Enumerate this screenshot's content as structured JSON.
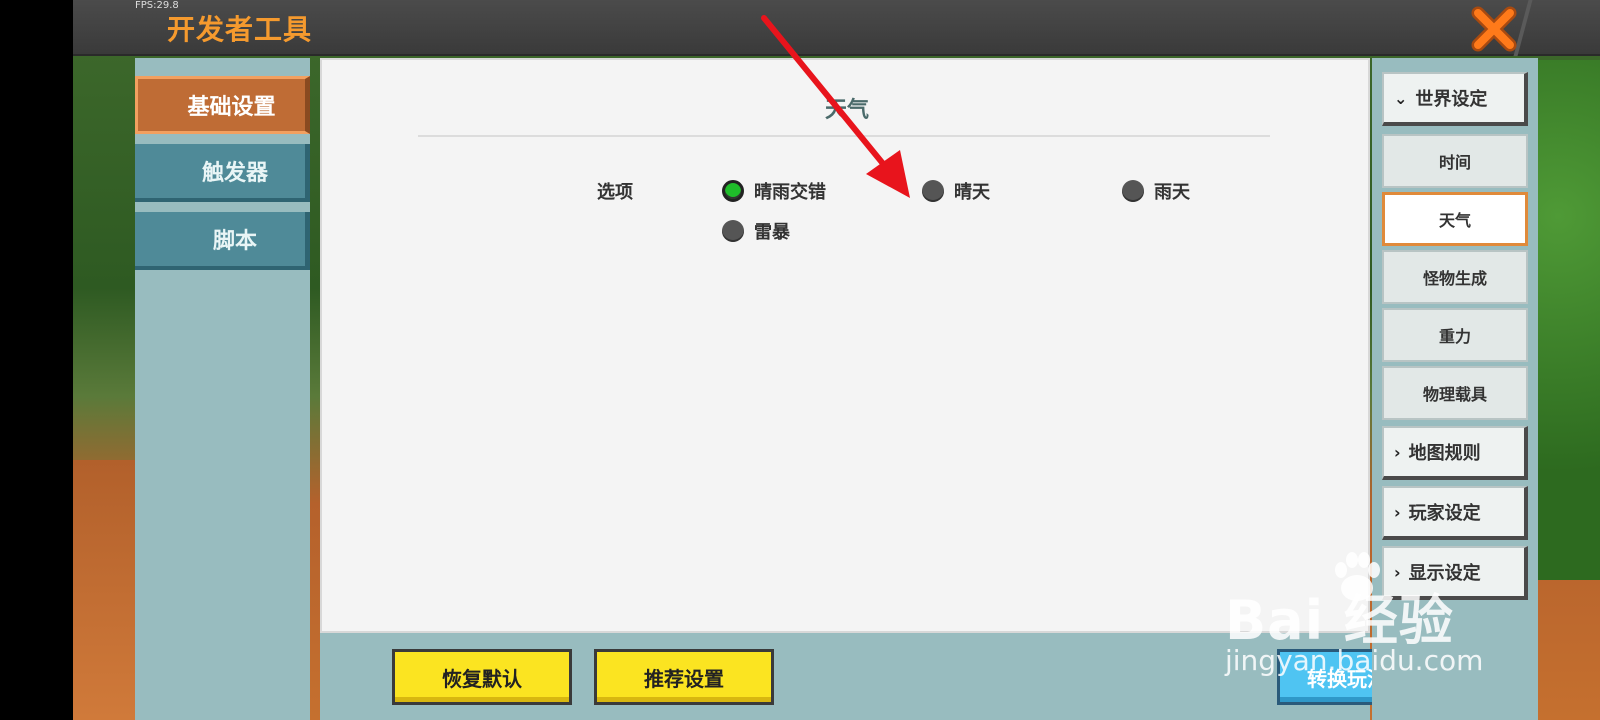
{
  "topbar": {
    "fps": "FPS:29.8",
    "title": "开发者工具"
  },
  "sidebar": {
    "items": [
      {
        "label": "基础设置",
        "active": true
      },
      {
        "label": "触发器",
        "active": false
      },
      {
        "label": "脚本",
        "active": false
      }
    ]
  },
  "main": {
    "section_title": "天气",
    "option_label": "选项",
    "options": [
      {
        "label": "晴雨交错",
        "selected": true
      },
      {
        "label": "晴天",
        "selected": false
      },
      {
        "label": "雨天",
        "selected": false
      },
      {
        "label": "雷暴",
        "selected": false
      }
    ]
  },
  "buttons": {
    "restore_default": "恢复默认",
    "recommended": "推荐设置",
    "convert_map": "转换玩法地图"
  },
  "right_panel": {
    "groups": [
      {
        "label": "世界设定",
        "expanded": true
      },
      {
        "label": "地图规则",
        "expanded": false
      },
      {
        "label": "玩家设定",
        "expanded": false
      },
      {
        "label": "显示设定",
        "expanded": false
      }
    ],
    "world_items": [
      {
        "label": "时间",
        "active": false
      },
      {
        "label": "天气",
        "active": true
      },
      {
        "label": "怪物生成",
        "active": false
      },
      {
        "label": "重力",
        "active": false
      },
      {
        "label": "物理载具",
        "active": false
      }
    ]
  },
  "watermark": {
    "brand": "Bai  经验",
    "url": "jingyan.baidu.com"
  },
  "colors": {
    "accent_orange": "#f59a2e",
    "selected_green": "#1fbd2a",
    "button_yellow": "#fbe421",
    "button_blue": "#4fc4f2"
  }
}
